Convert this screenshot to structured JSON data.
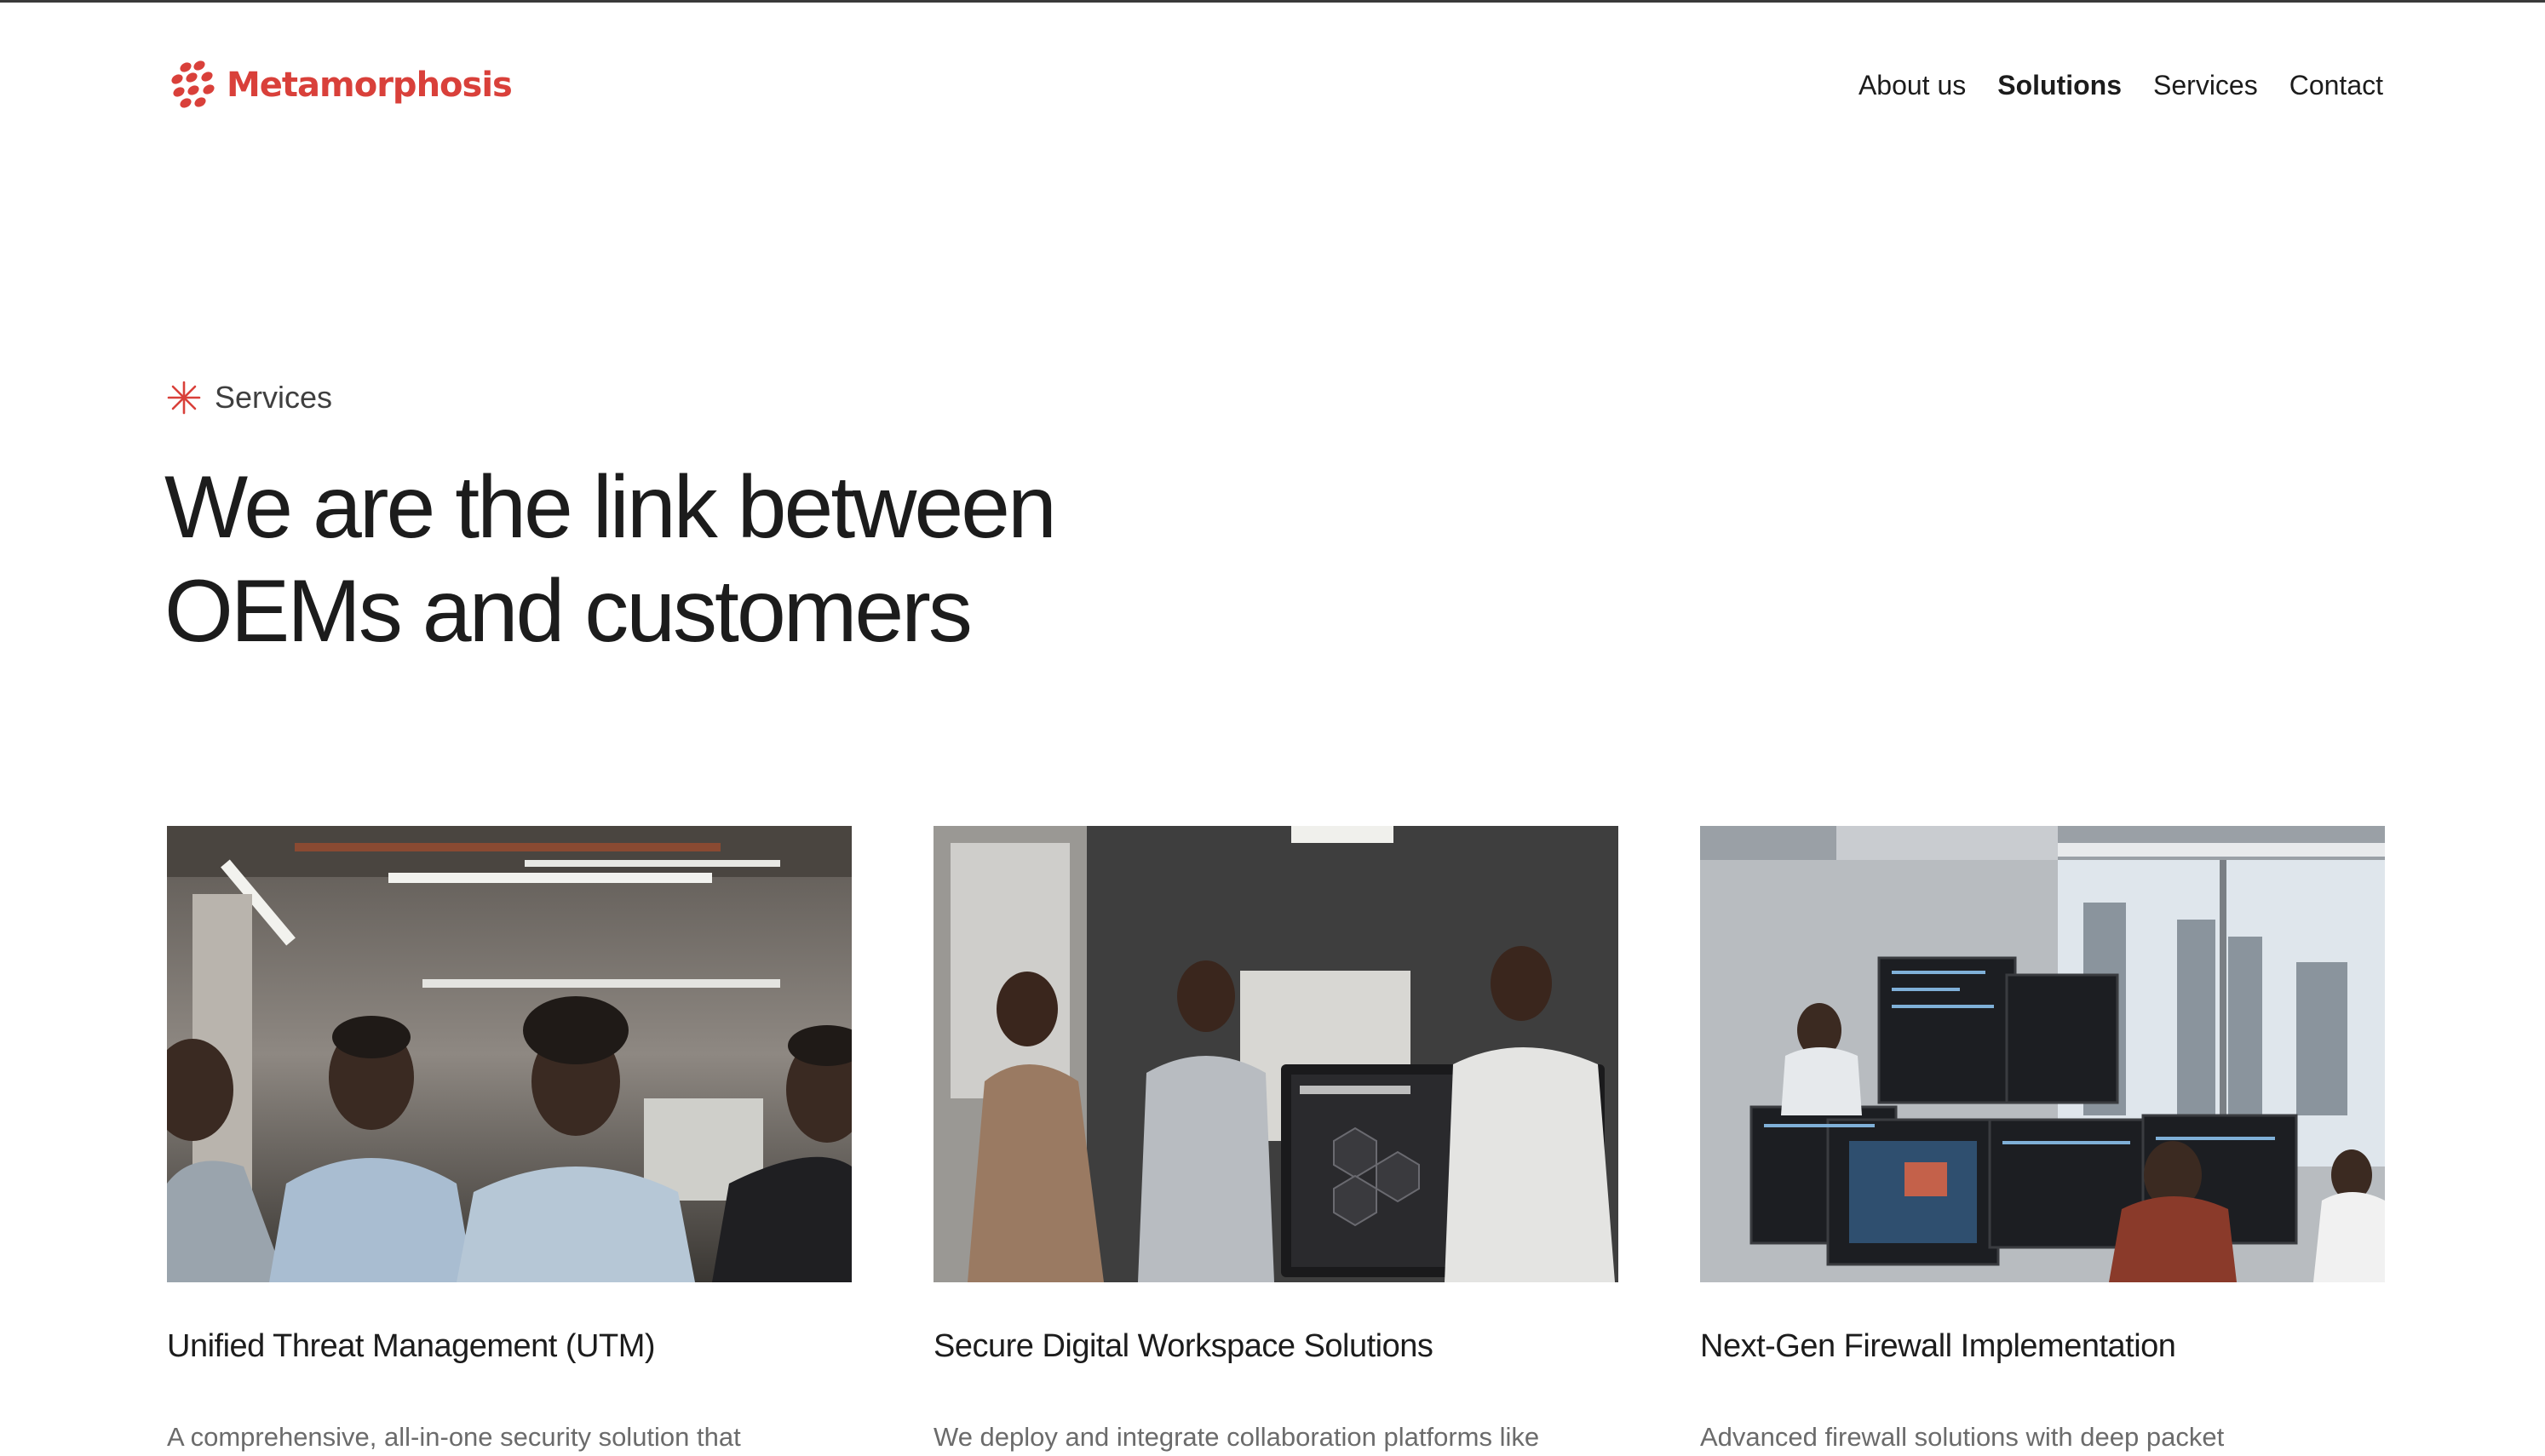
{
  "brand": {
    "name": "Metamorphosis",
    "accent": "#d9403a"
  },
  "nav": {
    "items": [
      {
        "label": "About us",
        "active": false
      },
      {
        "label": "Solutions",
        "active": true
      },
      {
        "label": "Services",
        "active": false
      },
      {
        "label": "Contact",
        "active": false
      }
    ]
  },
  "section": {
    "eyebrow": "Services",
    "eyebrow_icon": "asterisk-icon",
    "headline_line1": "We are the link between",
    "headline_line2": "OEMs and customers"
  },
  "cards": [
    {
      "title": "Unified Threat Management (UTM)",
      "description": "A comprehensive, all-in-one security solution that",
      "image": "team-portrait-photo"
    },
    {
      "title": "Secure Digital Workspace Solutions",
      "description": "We deploy and integrate collaboration platforms like",
      "image": "presentation-screen-photo"
    },
    {
      "title": "Next-Gen Firewall Implementation",
      "description": "Advanced firewall solutions with deep packet",
      "image": "security-operations-photo"
    }
  ]
}
